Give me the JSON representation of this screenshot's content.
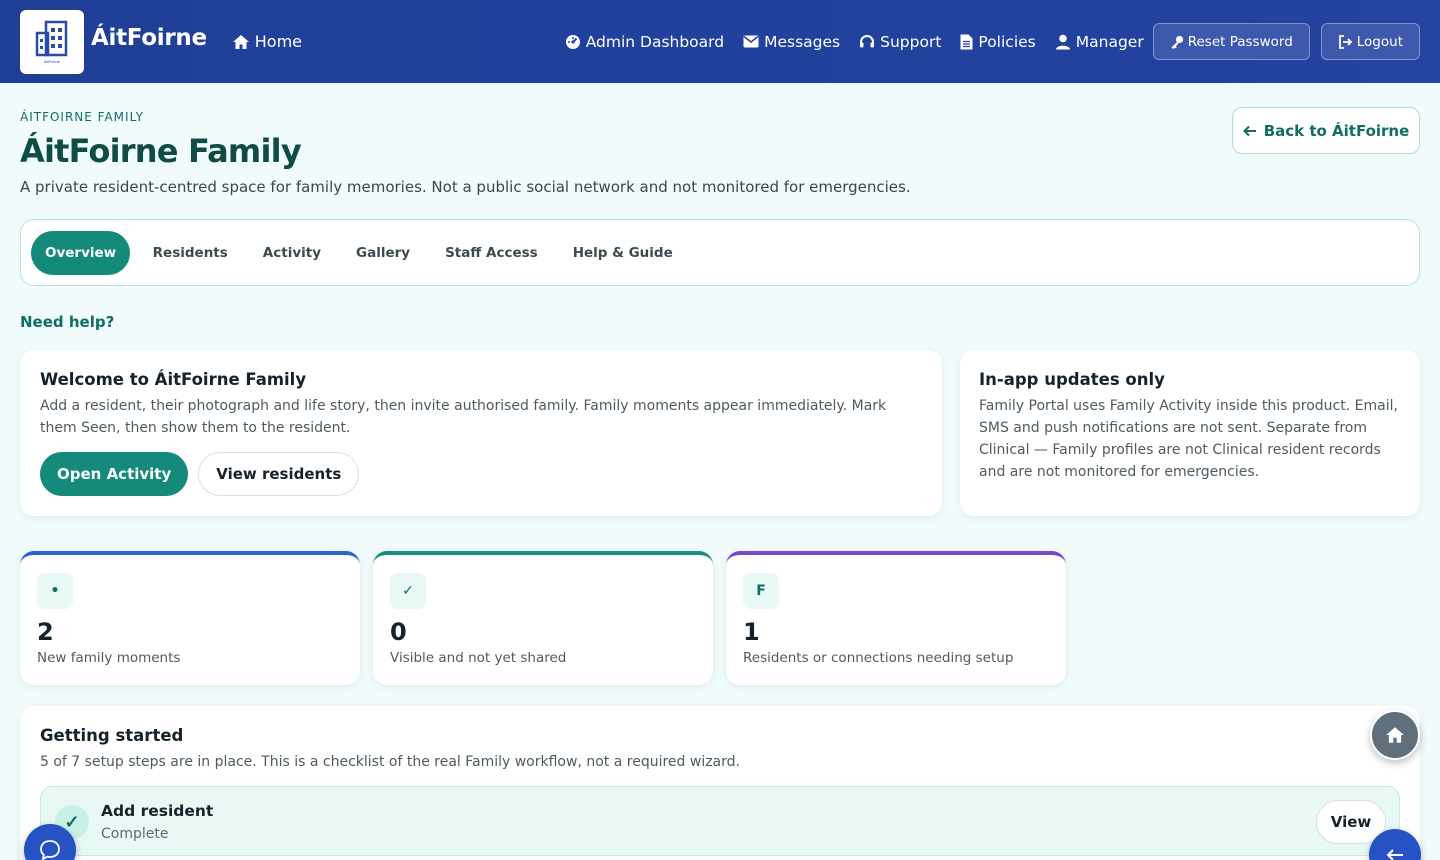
{
  "topbar": {
    "brand": "ÁitFoirne",
    "logo_caption": "ÁitFoirne",
    "home": "Home",
    "nav": [
      "Admin Dashboard",
      "Messages",
      "Support",
      "Policies",
      "Manager"
    ],
    "reset_password": "Reset Password",
    "logout": "Logout"
  },
  "header": {
    "eyebrow": "ÁITFOIRNE FAMILY",
    "title": "ÁitFoirne Family",
    "subtitle": "A private resident-centred space for family memories. Not a public social network and not monitored for emergencies.",
    "back_button": "Back to ÁitFoirne"
  },
  "tabs": [
    "Overview",
    "Residents",
    "Activity",
    "Gallery",
    "Staff Access",
    "Help & Guide"
  ],
  "need_help": "Need help?",
  "welcome": {
    "title": "Welcome to ÁitFoirne Family",
    "text": "Add a resident, their photograph and life story, then invite authorised family. Family moments appear immediately. Mark them Seen, then show them to the resident.",
    "primary_button": "Open Activity",
    "secondary_button": "View residents"
  },
  "updates": {
    "title": "In-app updates only",
    "text": "Family Portal uses Family Activity inside this product. Email, SMS and push notifications are not sent. Separate from Clinical — Family profiles are not Clinical resident records and are not monitored for emergencies."
  },
  "stats": [
    {
      "icon": "•",
      "value": "2",
      "label": "New family moments",
      "accent": "#2c62c9"
    },
    {
      "icon": "✓",
      "value": "0",
      "label": "Visible and not yet shared",
      "accent": "#1b8e82"
    },
    {
      "icon": "F",
      "value": "1",
      "label": "Residents or connections needing setup",
      "accent": "#7c47cc"
    }
  ],
  "getting_started": {
    "title": "Getting started",
    "text": "5 of 7 setup steps are in place. This is a checklist of the real Family workflow, not a required wizard.",
    "step_title": "Add resident",
    "step_status": "Complete",
    "step_button": "View"
  },
  "colors": {
    "nav_bg": "#2443a2",
    "accent": "#148a7b",
    "title": "#0f4c45"
  }
}
